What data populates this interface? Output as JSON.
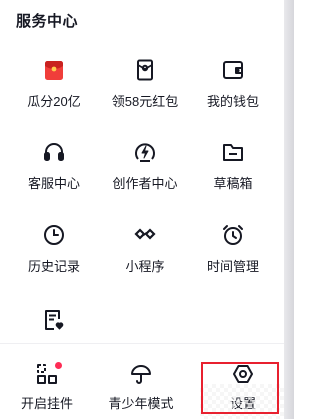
{
  "section": {
    "title": "服务中心"
  },
  "grid": [
    {
      "label": "瓜分20亿",
      "icon": "red-envelope-icon"
    },
    {
      "label": "领58元红包",
      "icon": "coupon-icon"
    },
    {
      "label": "我的钱包",
      "icon": "wallet-icon"
    },
    {
      "label": "客服中心",
      "icon": "headset-icon"
    },
    {
      "label": "创作者中心",
      "icon": "creator-bolt-icon"
    },
    {
      "label": "草稿箱",
      "icon": "folder-icon"
    },
    {
      "label": "历史记录",
      "icon": "clock-icon"
    },
    {
      "label": "小程序",
      "icon": "infinity-icon"
    },
    {
      "label": "时间管理",
      "icon": "alarm-icon"
    },
    {
      "icon": "note-heart-icon"
    }
  ],
  "bottom": [
    {
      "label": "开启挂件",
      "icon": "widget-icon",
      "badge": true
    },
    {
      "label": "青少年模式",
      "icon": "umbrella-icon"
    },
    {
      "label": "设置",
      "icon": "settings-hexagon-icon",
      "highlighted": true
    }
  ],
  "colors": {
    "accent": "#fe2c55",
    "highlight_box": "#e8202f",
    "envelope": "#f03e3a",
    "text": "#161823"
  }
}
